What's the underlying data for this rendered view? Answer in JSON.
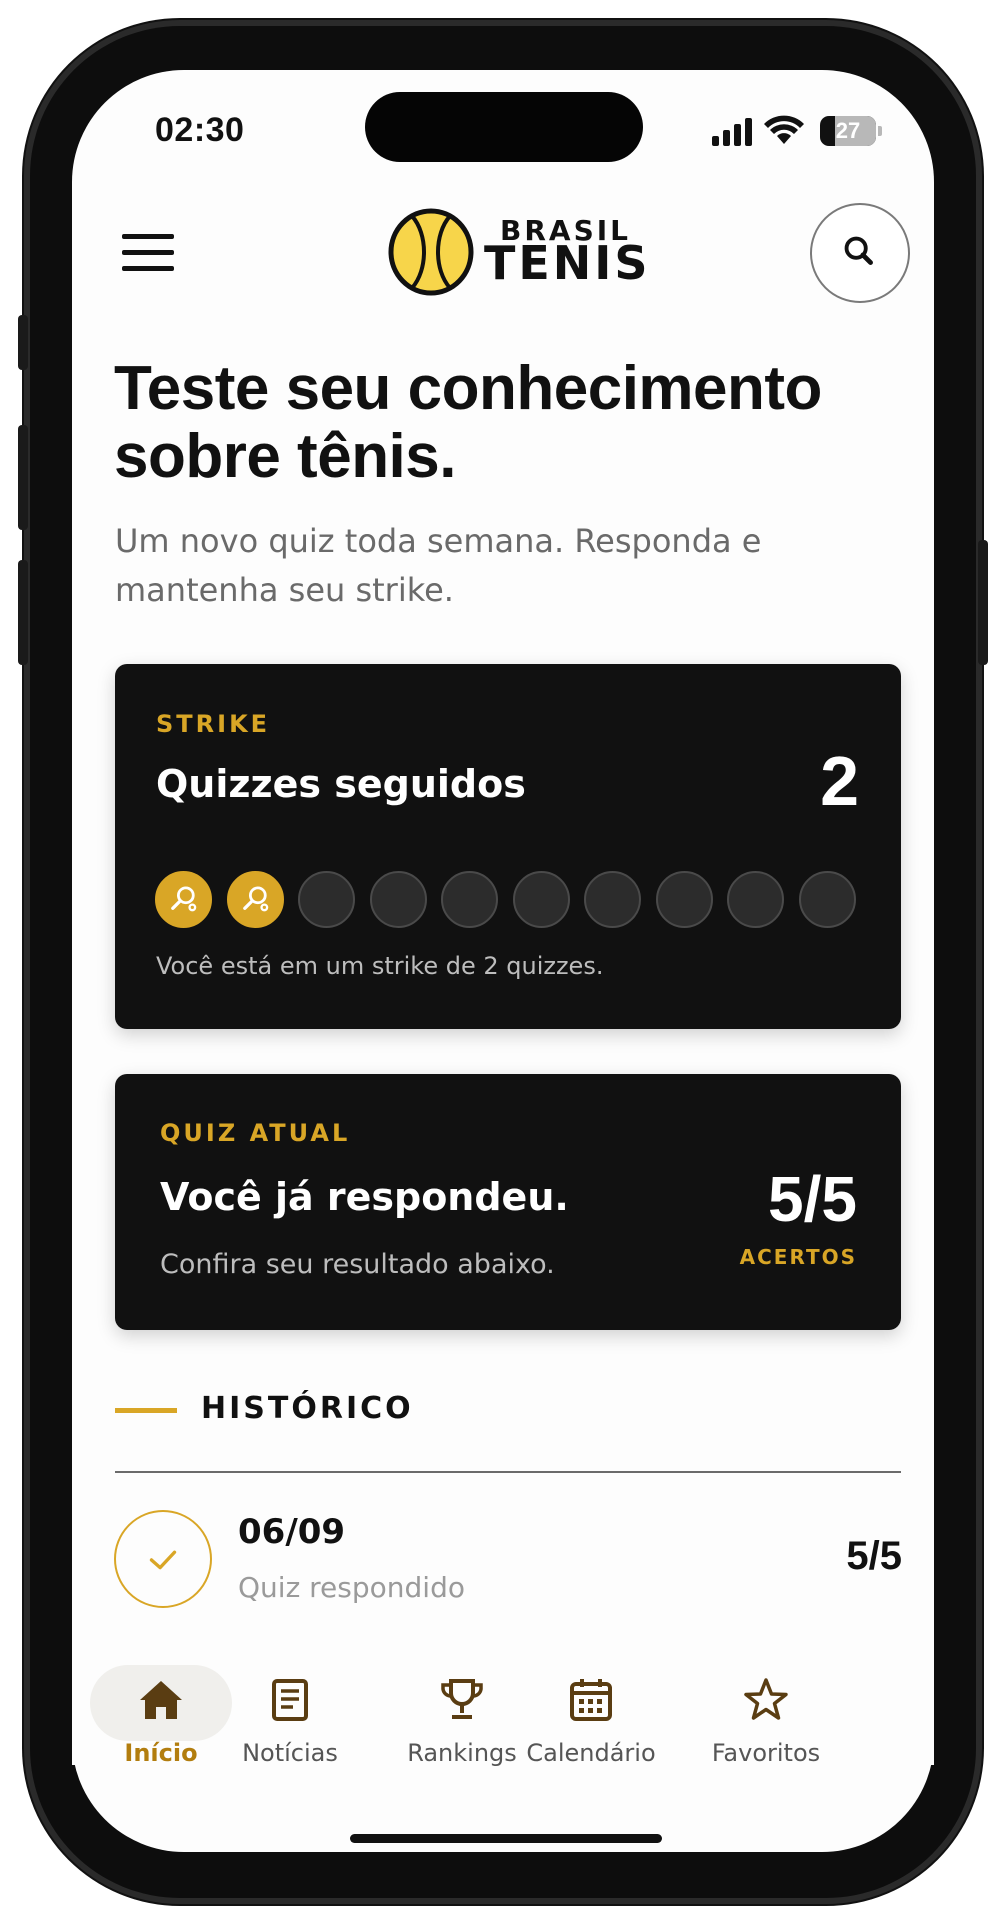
{
  "status_bar": {
    "time": "02:30",
    "battery_level": "27"
  },
  "header": {
    "logo_top": "BRASIL",
    "logo_bottom": "TENIS",
    "icons": [
      "menu-icon",
      "tennis-ball-icon",
      "search-icon"
    ]
  },
  "hero": {
    "title_line1": "Teste seu conhecimento",
    "title_line2": "sobre tênis.",
    "subtitle_line1": "Um novo quiz toda semana. Responda e",
    "subtitle_line2": "mantenha seu strike."
  },
  "strike_card": {
    "label": "STRIKE",
    "title": "Quizzes seguidos",
    "count": "2",
    "total_dots": 10,
    "filled_dots": 2,
    "note": "Você está em um strike de 2 quizzes."
  },
  "quiz_card": {
    "label": "QUIZ ATUAL",
    "title": "Você já respondeu.",
    "note": "Confira seu resultado abaixo.",
    "score": "5/5",
    "score_label": "ACERTOS"
  },
  "history": {
    "title": "HISTÓRICO",
    "items": [
      {
        "date": "06/09",
        "status": "Quiz respondido",
        "score": "5/5"
      }
    ]
  },
  "bottom_nav": {
    "items": [
      {
        "label": "Início",
        "icon": "home-icon",
        "active": true
      },
      {
        "label": "Notícias",
        "icon": "news-icon",
        "active": false
      },
      {
        "label": "Rankings",
        "icon": "trophy-icon",
        "active": false
      },
      {
        "label": "Calendário",
        "icon": "calendar-icon",
        "active": false
      },
      {
        "label": "Favoritos",
        "icon": "star-icon",
        "active": false
      }
    ]
  },
  "colors": {
    "accent": "#d9a626",
    "ball_yellow": "#f7d54a",
    "card_bg": "#111111",
    "nav_active": "#b27d0e",
    "nav_pill": "#f0efec"
  }
}
